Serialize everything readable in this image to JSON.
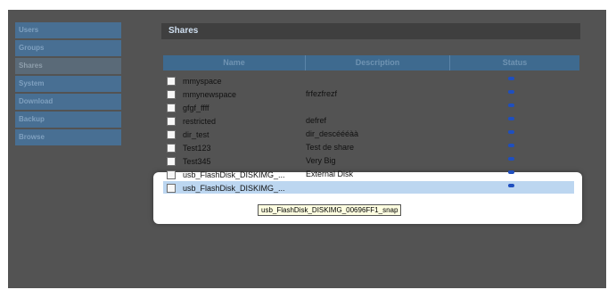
{
  "sidebar": {
    "items": [
      {
        "label": "Users"
      },
      {
        "label": "Groups"
      },
      {
        "label": "Shares"
      },
      {
        "label": "System"
      },
      {
        "label": "Download"
      },
      {
        "label": "Backup"
      },
      {
        "label": "Browse"
      }
    ],
    "active": "Shares"
  },
  "main": {
    "title": "Shares",
    "columns": [
      "Name",
      "Description",
      "Status"
    ],
    "rows": [
      {
        "name": "mmyspace",
        "description": ""
      },
      {
        "name": "mmynewspace",
        "description": "frfezfrezf"
      },
      {
        "name": "gfgf_ffff",
        "description": ""
      },
      {
        "name": "restricted",
        "description": "defref"
      },
      {
        "name": "dir_test",
        "description": "dir_descéééàà"
      },
      {
        "name": "Test123",
        "description": "Test de share"
      },
      {
        "name": "Test345",
        "description": "Very Big"
      },
      {
        "name": "usb_FlashDisk_DISKIMG_...",
        "description": "External Disk"
      },
      {
        "name": "usb_FlashDisk_DISKIMG_...",
        "description": ""
      }
    ],
    "tooltip": "usb_FlashDisk_DISKIMG_00696FF1_snap"
  },
  "colors": {
    "status_dot": "#1f4fbf",
    "highlight_row": "#bcd6f0"
  }
}
